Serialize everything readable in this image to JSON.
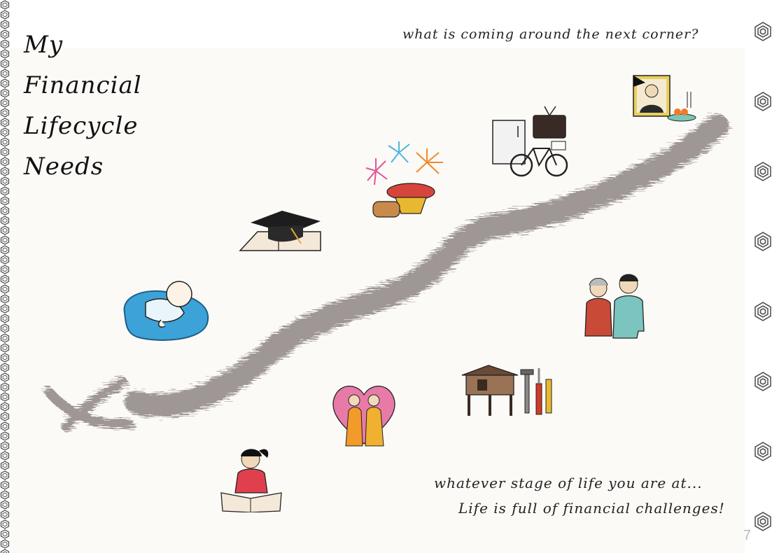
{
  "page": {
    "title_lines": [
      "My",
      "Financial",
      "Lifecycle",
      "Needs"
    ],
    "top_question": "what is coming around the next corner?",
    "bottom_line_1": "whatever stage of life you are at...",
    "bottom_line_2": "Life is full of financial challenges!",
    "page_number": "7"
  },
  "colors": {
    "path": "#8f8686",
    "border_pattern": "#444444",
    "background": "#fbfaf6"
  },
  "illustrations": [
    "baby-icon",
    "graduation-cap-icon",
    "festival-icon",
    "appliances-bicycle-icon",
    "funeral-portrait-icon",
    "elderly-couple-icon",
    "house-tools-icon",
    "wedding-couple-icon",
    "student-reading-icon",
    "start-cross-icon"
  ]
}
